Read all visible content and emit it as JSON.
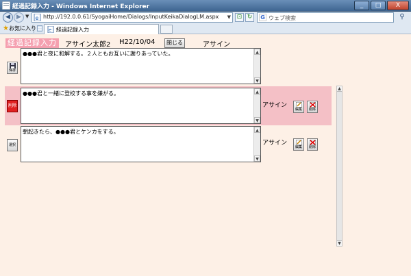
{
  "window": {
    "title": "経過記録入力 - Windows Internet Explorer",
    "controls": {
      "minimize": "_",
      "maximize": "□",
      "close": "X"
    }
  },
  "address_bar": {
    "url": "http://192.0.0.61/SyogaiHome/Dialogs/InputKeikaDialogLM.aspx",
    "search_placeholder": "ウェブ検索"
  },
  "tabs": {
    "favorites_label": "お気に入り",
    "active_tab_label": "経過記録入力"
  },
  "header": {
    "badge": "経過記録入力",
    "user_name": "アサイン太郎2",
    "date": "H22/10/04",
    "close_button": "閉じる",
    "assignee": "アサイン"
  },
  "records": [
    {
      "text": "●●●君と夜に和解する。２人ともお互いに謝りあっていた。",
      "side_button": "保存"
    },
    {
      "text": "●●●君と一緒に登校する事を嫌がる。",
      "side_button": "削除",
      "assignee": "アサイン",
      "edit_label": "編集",
      "delete_label": "削除"
    },
    {
      "text": "朝起きたら、●●●君とケンカをする。",
      "side_button": "選択",
      "assignee": "アサイン",
      "edit_label": "編集",
      "delete_label": "削除"
    }
  ],
  "colors": {
    "page_background": "#fdf0e6",
    "highlight": "#f4c0c6",
    "badge": "#f5a0b0",
    "delete_red": "#e02020"
  }
}
